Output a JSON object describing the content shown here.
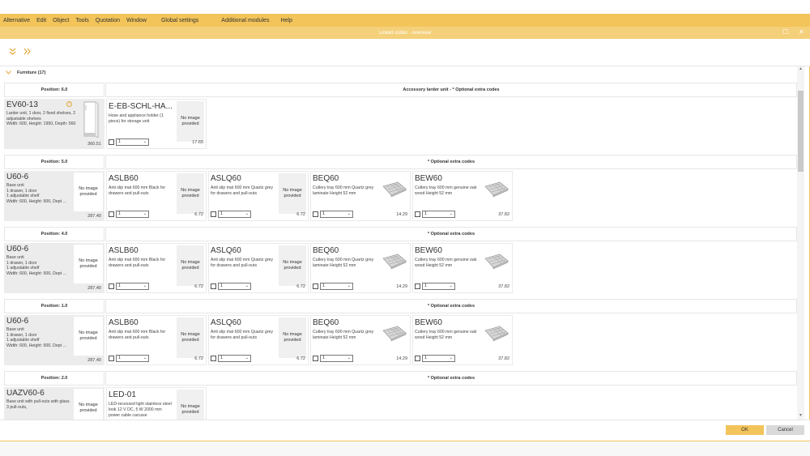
{
  "menu": [
    "Alternative",
    "Edit",
    "Object",
    "Tools",
    "Quotation",
    "Window",
    "Global settings",
    "Additional modules",
    "Help"
  ],
  "window": {
    "title": "Linked codes - overview"
  },
  "toolbar": {
    "collapse_icon": "double-chevron-down-icon",
    "expand_icon": "double-chevron-right-icon"
  },
  "section": {
    "label": "Furniture (17)"
  },
  "no_image_text": "No image provided",
  "groups": [
    {
      "position": "Position: 6.0",
      "header": "Accessory larder unit - * Optional extra codes",
      "base": {
        "code": "EV60-13",
        "desc": "Larder unit, 1 door, 2 fixed shelves, 2 adjustable shelves\nWidth: 600, Height: 1950, Depth: 560",
        "price": "360.51",
        "has_image": true
      },
      "items": [
        {
          "code": "E-EB-SCHL-HA...",
          "desc": "Hose and appliance holder (1 piece) for storage unit",
          "qty": "1",
          "price": "17.65",
          "image": "none"
        }
      ]
    },
    {
      "position": "Position: 5.0",
      "header": "* Optional extra codes",
      "base": {
        "code": "U60-6",
        "desc": "Base unit\n1 drawer, 1 door\n1 adjustable shelf\nWidth: 600, Height: 900, Dept ...",
        "price": "287.40",
        "has_image": false
      },
      "items": [
        {
          "code": "ASLB60",
          "desc": "Anti slip mat 600 mm Black for drawers and pull-outs",
          "qty": "1",
          "price": "6.72",
          "image": "none"
        },
        {
          "code": "ASLQ60",
          "desc": "Anti slip mat 600 mm Quartz grey for drawers and pull-outs",
          "qty": "1",
          "price": "6.72",
          "image": "none"
        },
        {
          "code": "BEQ60",
          "desc": "Cutlery tray 600 mm Quartz grey laminate Height 52 mm",
          "qty": "1",
          "price": "14.29",
          "image": "tray"
        },
        {
          "code": "BEW60",
          "desc": "Cutlery tray 600 mm genuine oak wood Height 52 mm",
          "qty": "1",
          "price": "37.82",
          "image": "tray"
        }
      ]
    },
    {
      "position": "Position: 4.0",
      "header": "* Optional extra codes",
      "base": {
        "code": "U60-6",
        "desc": "Base unit\n1 drawer, 1 door\n1 adjustable shelf\nWidth: 600, Height: 900, Dept ...",
        "price": "287.40",
        "has_image": false
      },
      "items": [
        {
          "code": "ASLB60",
          "desc": "Anti slip mat 600 mm Black for drawers and pull-outs",
          "qty": "1",
          "price": "6.72",
          "image": "none"
        },
        {
          "code": "ASLQ60",
          "desc": "Anti slip mat 600 mm Quartz grey for drawers and pull-outs",
          "qty": "1",
          "price": "6.72",
          "image": "none"
        },
        {
          "code": "BEQ60",
          "desc": "Cutlery tray 600 mm Quartz grey laminate Height 52 mm",
          "qty": "1",
          "price": "14.29",
          "image": "tray"
        },
        {
          "code": "BEW60",
          "desc": "Cutlery tray 600 mm genuine oak wood Height 52 mm",
          "qty": "1",
          "price": "37.82",
          "image": "tray"
        }
      ]
    },
    {
      "position": "Position: 1.0",
      "header": "* Optional extra codes",
      "base": {
        "code": "U60-6",
        "desc": "Base unit\n1 drawer, 1 door\n1 adjustable shelf\nWidth: 600, Height: 900, Dept ...",
        "price": "287.40",
        "has_image": false
      },
      "items": [
        {
          "code": "ASLB60",
          "desc": "Anti slip mat 600 mm Black for drawers and pull-outs",
          "qty": "1",
          "price": "6.72",
          "image": "none"
        },
        {
          "code": "ASLQ60",
          "desc": "Anti slip mat 600 mm Quartz grey for drawers and pull-outs",
          "qty": "1",
          "price": "6.72",
          "image": "none"
        },
        {
          "code": "BEQ60",
          "desc": "Cutlery tray 600 mm Quartz grey laminate Height 52 mm",
          "qty": "1",
          "price": "14.29",
          "image": "tray"
        },
        {
          "code": "BEW60",
          "desc": "Cutlery tray 600 mm genuine oak wood Height 52 mm",
          "qty": "1",
          "price": "37.82",
          "image": "tray"
        }
      ]
    },
    {
      "position": "Position: 2.0",
      "header": "* Optional extra codes",
      "base": {
        "code": "UAZV60-6",
        "desc": "Base unit with pull-outs with glass\n3 pull-outs,",
        "price": "",
        "has_image": false
      },
      "items": [
        {
          "code": "LED-01",
          "desc": "LED-recessed light stainless steel look 12 V DC, 5 W 2000 mm power cable carcase",
          "qty": "1",
          "price": "",
          "image": "none"
        }
      ]
    }
  ],
  "footer": {
    "ok": "OK",
    "cancel": "Cancel"
  },
  "colors": {
    "accent": "#f2c45a",
    "accent_light": "#f5d07a",
    "icon_orange": "#e6a83b"
  }
}
